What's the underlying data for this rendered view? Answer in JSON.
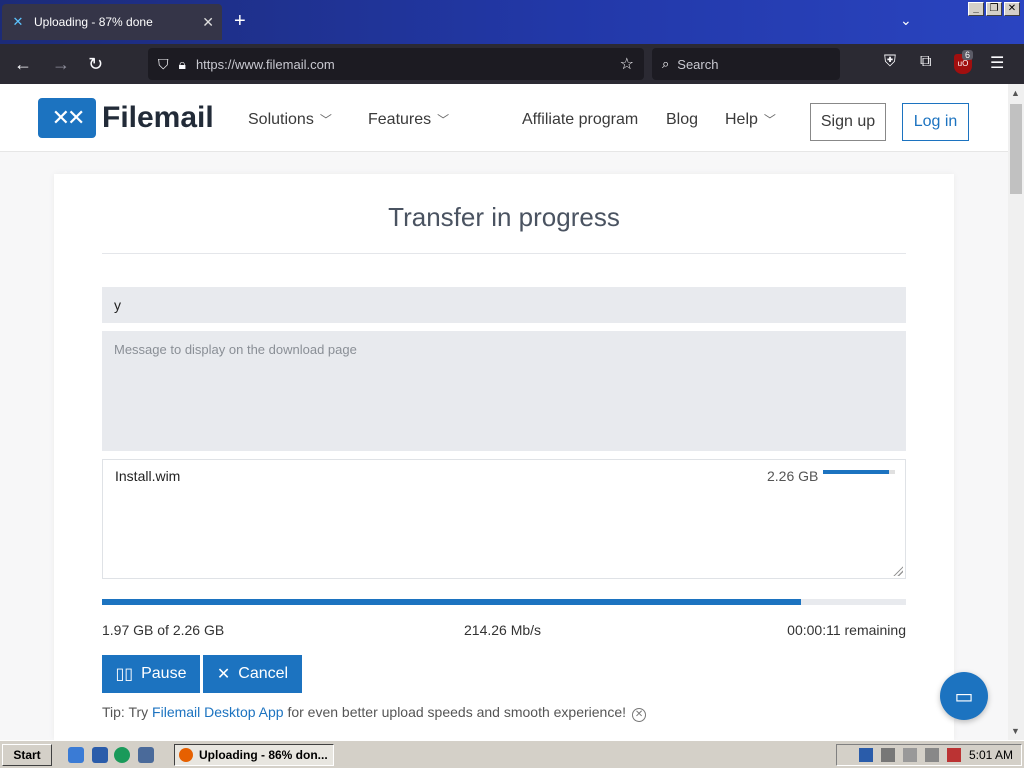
{
  "browser": {
    "tab_title": "Uploading - 87% done",
    "new_tab_label": "+",
    "url": "https://www.filemail.com",
    "search_placeholder": "Search",
    "extension_badge": "6",
    "icons": [
      "back-icon",
      "forward-icon",
      "reload-icon",
      "shield-icon",
      "lock-icon",
      "star-icon",
      "search-icon",
      "pocket-icon",
      "extensions-icon",
      "ublock-icon",
      "menu-icon"
    ]
  },
  "site": {
    "logo_text": "Filemail",
    "nav": {
      "solutions": "Solutions",
      "features": "Features",
      "affiliate": "Affiliate program",
      "blog": "Blog",
      "help": "Help"
    },
    "signup_label": "Sign up",
    "login_label": "Log in"
  },
  "transfer": {
    "title": "Transfer in progress",
    "subject_value": "y",
    "message_placeholder": "Message to display on the download page",
    "file": {
      "name": "Install.wim",
      "size": "2.26 GB",
      "progress": 0.92
    },
    "overall_progress": 0.87,
    "transferred": "1.97 GB of 2.26 GB",
    "speed": "214.26 Mb/s",
    "remaining": "00:00:11 remaining",
    "pause_label": "Pause",
    "cancel_label": "Cancel",
    "tip_prefix": "Tip: Try ",
    "tip_link": "Filemail Desktop App",
    "tip_suffix": " for even better upload speeds and smooth experience!"
  },
  "taskbar": {
    "start_label": "Start",
    "task_label": "Uploading - 86% don...",
    "clock": "5:01 AM"
  },
  "colors": {
    "brand_blue": "#1c73c0",
    "tabbar": "#2238a8",
    "toolbar": "#2b2a33"
  }
}
